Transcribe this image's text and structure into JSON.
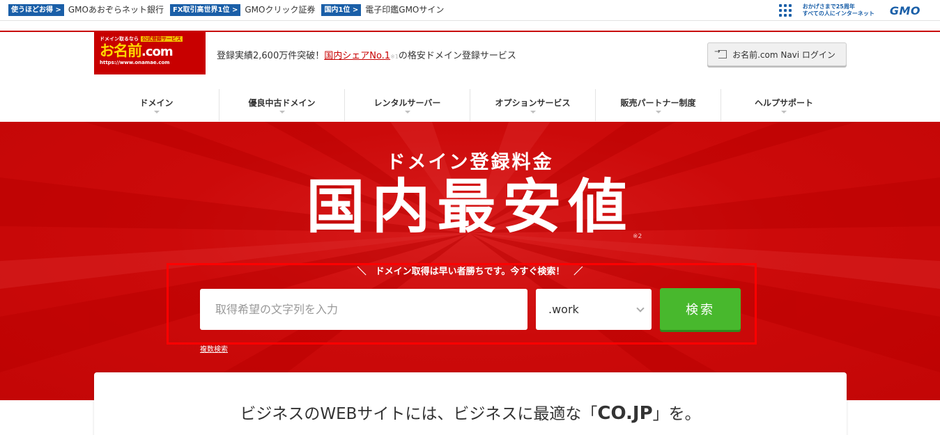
{
  "topbar": {
    "items": [
      {
        "badge": "使うほどお得 >",
        "link": "GMOあおぞらネット銀行"
      },
      {
        "badge": "FX取引高世界1位 >",
        "link": "GMOクリック証券"
      },
      {
        "badge": "国内1位 >",
        "link": "電子印鑑GMOサイン"
      }
    ],
    "anniversary_line1": "おかげさまで25周年",
    "anniversary_line2": "すべての人にインターネット",
    "brand": "GMO"
  },
  "header": {
    "logo_line1": "ドメイン取るなら",
    "logo_badge": "公式登録サービス",
    "logo_main": "お名前",
    "logo_dotcom": ".com",
    "logo_url": "https://www.onamae.com",
    "tagline_before": "登録実績2,600万件突破！",
    "tagline_share": "国内シェアNo.1",
    "tagline_note": "※1",
    "tagline_after": "の格安ドメイン登録サービス",
    "login_label": "お名前.com Navi ログイン"
  },
  "nav": {
    "items": [
      "ドメイン",
      "優良中古ドメイン",
      "レンタルサーバー",
      "オプションサービス",
      "販売パートナー制度",
      "ヘルプサポート"
    ]
  },
  "hero": {
    "subtitle": "ドメイン登録料金",
    "title": "国内最安値",
    "note": "※2",
    "caption": "＼　ドメイン取得は早い者勝ちです。今すぐ検索！　／",
    "search_placeholder": "取得希望の文字列を入力",
    "tld_value": ".work",
    "search_button": "検索",
    "multi_search": "複数検索"
  },
  "content": {
    "text_before": "ビジネスのWEBサイトには、ビジネスに最適な「",
    "text_bold": "CO.JP",
    "text_after": "」を。"
  },
  "colors": {
    "brand_red": "#c80000",
    "badge_blue": "#1a5fa8",
    "search_green": "#48b82d"
  }
}
